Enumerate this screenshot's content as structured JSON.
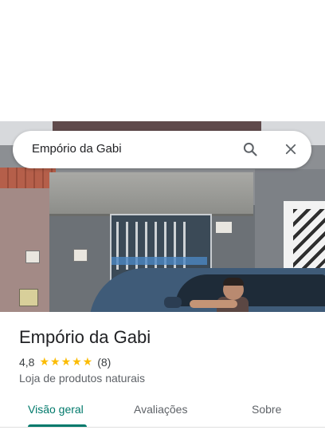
{
  "search": {
    "query": "Empório da Gabi",
    "search_icon": "search-icon",
    "close_icon": "close-icon"
  },
  "place": {
    "name": "Empório da Gabi",
    "rating": "4,8",
    "stars": "★★★★★",
    "review_count": "(8)",
    "category": "Loja de produtos naturais"
  },
  "tabs": [
    {
      "label": "Visão geral",
      "active": true
    },
    {
      "label": "Avaliações",
      "active": false
    },
    {
      "label": "Sobre",
      "active": false
    }
  ],
  "colors": {
    "accent": "#00796b",
    "star": "#fbbc04"
  }
}
